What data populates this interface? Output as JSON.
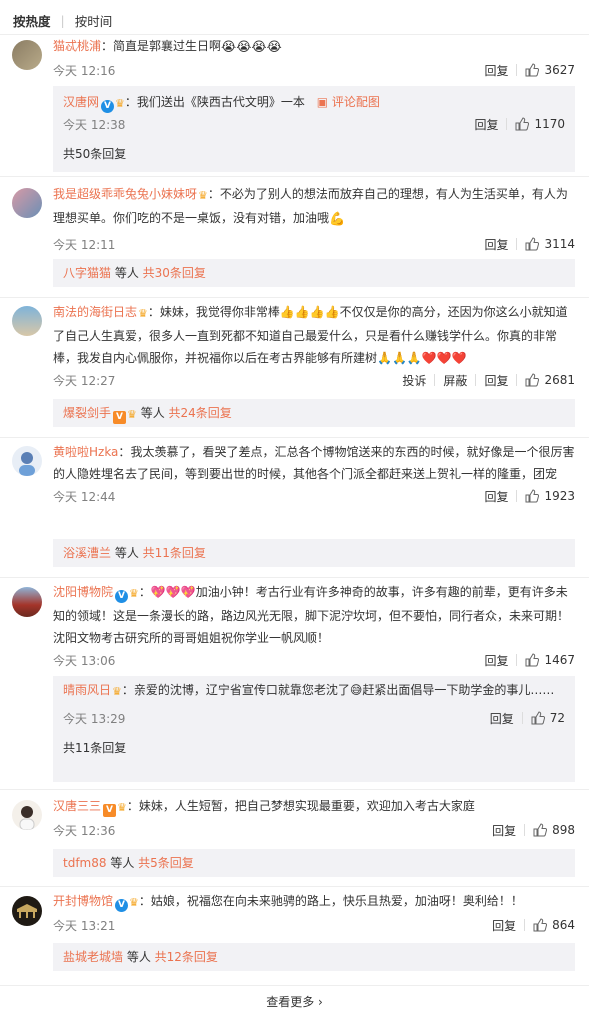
{
  "sort": {
    "hot": "按热度",
    "time": "按时间"
  },
  "like_icon": "thumbs-up-icon",
  "reply_label": "回复",
  "report_label": "投诉",
  "block_label": "屏蔽",
  "comments": [
    {
      "user": "猫忒桃浦",
      "text": "简直是郭襄过生日啊",
      "emoji": "😭😭😭😭",
      "time": "今天 12:16",
      "likes": "3627",
      "sub": {
        "user": "汉唐网",
        "text": "我们送出《陕西古代文明》一本",
        "extra": "评论配图",
        "time": "今天 12:38",
        "likes": "1170"
      },
      "more": "共50条回复"
    },
    {
      "user": "我是超级乖乖兔兔小妹妹呀",
      "text": "不必为了别人的想法而放弃自己的理想，有人为生活买单，有人为理想买单。你们吃的不是一桌饭，没有对错，加油哦",
      "time": "今天 12:11",
      "likes": "3114",
      "more_user": "八字猫猫",
      "more_mid": " 等人 ",
      "more": "共30条回复"
    },
    {
      "user": "南法的海街日志",
      "text": "妹妹，我觉得你非常棒👍👍👍👍不仅仅是你的高分，还因为你这么小就知道了自己人生真爱，很多人一直到死都不知道自己最爱什么，只是看什么赚钱学什么。你真的非常棒，我发自内心佩服你，并祝福你以后在考古界能够有所建树🙏🙏🙏❤️❤️❤️",
      "time": "今天 12:27",
      "likes": "2681",
      "more_user": "爆裂剑手",
      "more_mid": " 等人 ",
      "more": "共24条回复"
    },
    {
      "user": "黄啦啦Hzka",
      "text": "我太羡慕了，看哭了差点，汇总各个博物馆送来的东西的时候，就好像是一个很厉害的人隐姓埋名去了民间，等到要出世的时候，其他各个门派全都赶来送上贺礼一样的隆重，团宠",
      "time": "今天 12:44",
      "likes": "1923",
      "more_user": "浴溪漕兰",
      "more_mid": " 等人 ",
      "more": "共11条回复"
    },
    {
      "user": "沈阳博物院",
      "text": "💖💖💖加油小钟！考古行业有许多神奇的故事，许多有趣的前辈，更有许多未知的领域！这是一条漫长的路，路边风光无限，脚下泥泞坎坷，但不要怕，同行者众，未来可期！沈阳文物考古研究所的哥哥姐姐祝你学业一帆风顺！",
      "time": "今天 13:06",
      "likes": "1467",
      "sub": {
        "user": "晴雨风日",
        "text": "亲爱的沈博，辽宁省宣传口就靠您老沈了😅赶紧出面倡导一下助学金的事儿……",
        "time": "今天 13:29",
        "likes": "72"
      },
      "more": "共11条回复"
    },
    {
      "user": "汉唐三三",
      "text": "妹妹，人生短暂，把自己梦想实现最重要，欢迎加入考古大家庭",
      "time": "今天 12:36",
      "likes": "898",
      "more_user": "tdfm88",
      "more_mid": " 等人 ",
      "more": "共5条回复"
    },
    {
      "user": "开封博物馆",
      "text": "姑娘，祝福您在向未来驰骋的路上，快乐且热爱，加油呀！奥利给！！",
      "time": "今天 13:21",
      "likes": "864",
      "more_user": "盐城老城墙",
      "more_mid": " 等人 ",
      "more": "共12条回复"
    }
  ],
  "load_more": "查看更多 ›",
  "colors": {
    "accent": "#eb7350",
    "reply_bg": "#f2f2f5",
    "meta": "#808080"
  }
}
